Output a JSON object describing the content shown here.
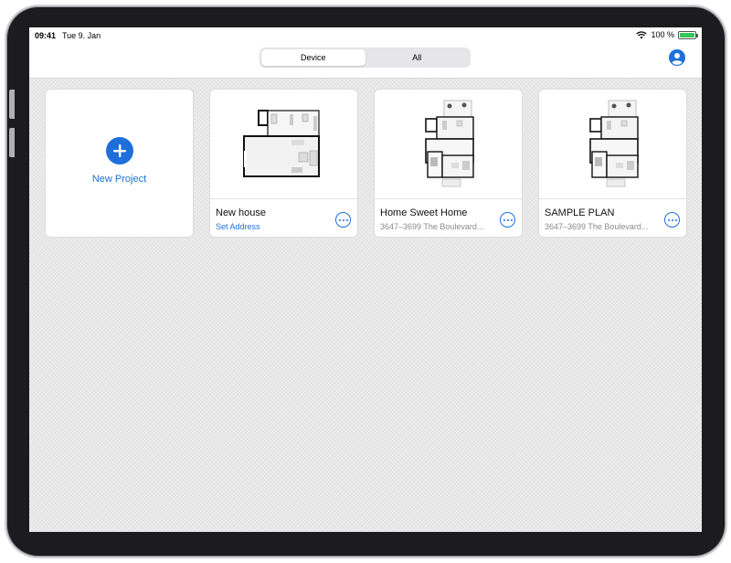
{
  "status_bar": {
    "time": "09:41",
    "date": "Tue 9. Jan",
    "battery": "100 %",
    "battery_level": 1.0
  },
  "segmented_control": {
    "options": [
      {
        "label": "Device",
        "selected": true
      },
      {
        "label": "All",
        "selected": false
      }
    ]
  },
  "profile": {
    "icon": "person-circle-icon"
  },
  "new_project": {
    "label": "New Project",
    "icon": "plus-icon"
  },
  "projects": [
    {
      "title": "New house",
      "subtitle": "Set Address",
      "subtitle_is_link": true,
      "thumb": "floorplan-simple"
    },
    {
      "title": "Home Sweet Home",
      "subtitle": "3647–3699 The Boulevard...",
      "subtitle_is_link": false,
      "thumb": "floorplan-detailed"
    },
    {
      "title": "SAMPLE PLAN",
      "subtitle": "3647–3699 The Boulevard...",
      "subtitle_is_link": false,
      "thumb": "floorplan-detailed"
    }
  ],
  "colors": {
    "accent": "#1e6fd9",
    "background": "#ededed",
    "card": "#ffffff",
    "battery": "#34c759"
  }
}
